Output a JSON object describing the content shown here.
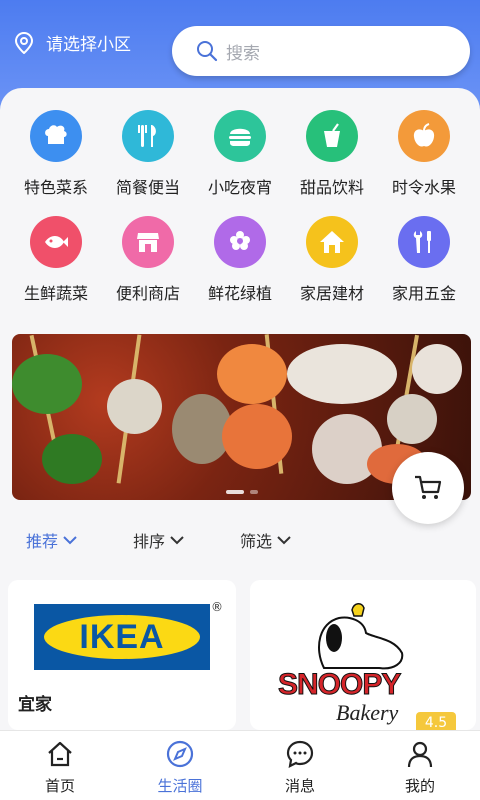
{
  "header": {
    "location_label": "请选择小区",
    "search_placeholder": "搜索"
  },
  "categories": [
    {
      "label": "特色菜系",
      "icon": "chef-hat-icon",
      "color": "#3d8ff0"
    },
    {
      "label": "简餐便当",
      "icon": "fork-knife-icon",
      "color": "#2fb8d8"
    },
    {
      "label": "小吃夜宵",
      "icon": "burger-icon",
      "color": "#2dc59a"
    },
    {
      "label": "甜品饮料",
      "icon": "drink-icon",
      "color": "#27c07a"
    },
    {
      "label": "时令水果",
      "icon": "apple-icon",
      "color": "#f39a3a"
    },
    {
      "label": "生鲜蔬菜",
      "icon": "fish-icon",
      "color": "#f0506a"
    },
    {
      "label": "便利商店",
      "icon": "store-icon",
      "color": "#f06aa8"
    },
    {
      "label": "鲜花绿植",
      "icon": "flower-icon",
      "color": "#b06ae8"
    },
    {
      "label": "家居建材",
      "icon": "house-icon",
      "color": "#f5c21c"
    },
    {
      "label": "家用五金",
      "icon": "tools-icon",
      "color": "#6a6ef0"
    }
  ],
  "banner": {
    "dot_count": 2,
    "active_dot": 0
  },
  "filters": [
    {
      "label": "推荐",
      "active": true
    },
    {
      "label": "排序",
      "active": false
    },
    {
      "label": "筛选",
      "active": false
    }
  ],
  "shops": [
    {
      "name": "宜家",
      "logo_text": "IKEA",
      "reg_mark": "®"
    },
    {
      "logo_text": "SNOOPY",
      "logo_subtext": "Bakery",
      "rating": "4.5"
    }
  ],
  "tabbar": [
    {
      "label": "首页",
      "icon": "home-icon",
      "active": false
    },
    {
      "label": "生活圈",
      "icon": "compass-icon",
      "active": true
    },
    {
      "label": "消息",
      "icon": "chat-icon",
      "active": false
    },
    {
      "label": "我的",
      "icon": "user-icon",
      "active": false
    }
  ],
  "colors": {
    "brand_blue": "#4d7cf0",
    "active_text": "#4a72d8"
  }
}
